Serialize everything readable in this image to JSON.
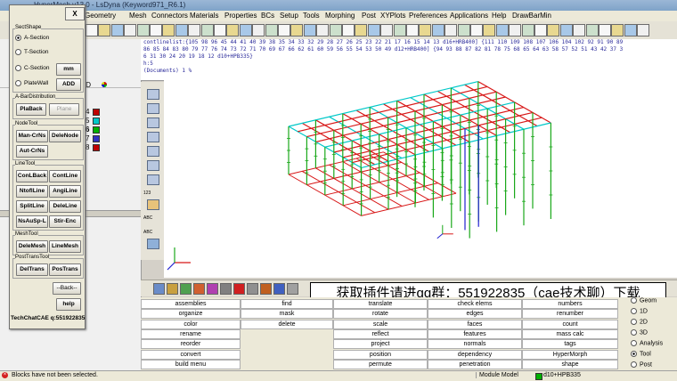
{
  "window": {
    "title": "HyperMesh v13.0 - LsDyna (Keyword971_R6.1)"
  },
  "menu": [
    "Geometry",
    "Mesh",
    "Connectors",
    "Materials",
    "Properties",
    "BCs",
    "Setup",
    "Tools",
    "Morphing",
    "Post",
    "XYPlots",
    "Preferences",
    "Applications",
    "Help",
    "DrawBarMin"
  ],
  "command_window": {
    "lines": [
      "contlinelist:{105 98 96 45 44 41 40 39 38 35 34 33 32 29 28 27 26 25 23 22 21 17 16 15 14 13 d16+HRB400] {111 110 109 108 107 106 104 102 92 91 90 89",
      "86 85 84 83 80 79 77 76 74 73 72 71 70 69 67 66 62 61 60 59 56 55 54 53 50 49 d12+HRB400] {94 93 88 87 82 81 78 75 68 65 64 63 58 57 52 51 43 42 37 3",
      "6 31 30 24 20 19 18 12 d10+HPB335}",
      "h:5",
      "(Documents) 1 %"
    ]
  },
  "model_browser": {
    "id_label": "ID",
    "rows": [
      {
        "id": "4",
        "color": "#c00000"
      },
      {
        "id": "5",
        "color": "#00c8c8"
      },
      {
        "id": "6",
        "color": "#00b000"
      },
      {
        "id": "7",
        "color": "#3030c0"
      },
      {
        "id": "8",
        "color": "#c00000"
      }
    ]
  },
  "dialog": {
    "close": "X",
    "sect_shape": {
      "label": "SectShape",
      "options": [
        {
          "label": "A-Section",
          "selected": true
        },
        {
          "label": "T-Section",
          "selected": false
        },
        {
          "label": "C-Section",
          "selected": false
        },
        {
          "label": "PlateWall",
          "selected": false
        }
      ],
      "mm": "mm",
      "add": "ADD"
    },
    "bar_distribution": {
      "label": "A-BarDistribution",
      "placeback": "PlaBack",
      "plane": "Plane"
    },
    "node_tool": {
      "label": "NodeTool",
      "man_crns": "Man-CrNs",
      "delenode": "DeleNode",
      "aut_crns": "Aut-CrNs"
    },
    "line_tool": {
      "label": "LineTool",
      "conlback": "ConLBack",
      "contline": "ContLine",
      "ntoflline": "NtoflLine",
      "angiline": "AngiLine",
      "splitline": "SplitLine",
      "deleline": "DeleLine",
      "nsausp": "NsAuSp-L",
      "stir_enc": "Stir-Enc"
    },
    "mesh_tool": {
      "label": "MeshTool",
      "delemesh": "DeleMesh",
      "linemesh": "LineMesh"
    },
    "post_trans": {
      "label": "PostTransTool",
      "deltrans": "DelTrans",
      "postrans": "PosTrans"
    },
    "back": "--Back--",
    "help": "help",
    "footer": "TechChatCAE q:551922835"
  },
  "banner": "获取插件请进qq群：551922835（cae技术聊）下载",
  "vtool_labels": [
    "123",
    "ABC",
    "ABC"
  ],
  "panel": {
    "columns": [
      [
        "assemblies",
        "organize",
        "color",
        "rename",
        "reorder",
        "convert",
        "build menu"
      ],
      [
        "find",
        "mask",
        "delete",
        "",
        "",
        "",
        ""
      ],
      [
        "translate",
        "rotate",
        "scale",
        "reflect",
        "project",
        "position",
        "permute"
      ],
      [
        "check elems",
        "edges",
        "faces",
        "features",
        "normals",
        "dependency",
        "penetration"
      ],
      [
        "numbers",
        "renumber",
        "count",
        "mass calc",
        "tags",
        "HyperMorph",
        "shape"
      ]
    ]
  },
  "pages": [
    {
      "label": "Geom",
      "selected": false
    },
    {
      "label": "1D",
      "selected": false
    },
    {
      "label": "2D",
      "selected": false
    },
    {
      "label": "3D",
      "selected": false
    },
    {
      "label": "Analysis",
      "selected": false
    },
    {
      "label": "Tool",
      "selected": true
    },
    {
      "label": "Post",
      "selected": false
    }
  ],
  "status": {
    "message": "Blocks have not been selected.",
    "model": "Module Model",
    "component": "d10+HPB335"
  }
}
